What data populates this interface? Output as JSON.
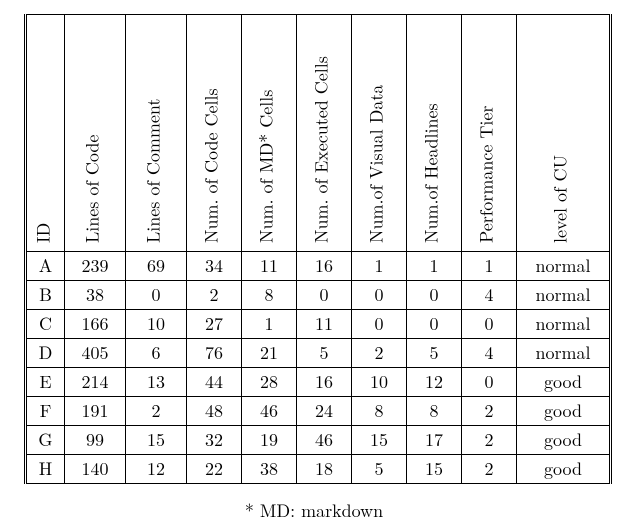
{
  "chart_data": {
    "type": "table",
    "title": "",
    "columns": [
      "ID",
      "Lines of Code",
      "Lines of Comment",
      "Num. of Code Cells",
      "Num. of MD* Cells",
      "Num. of Executed Cells",
      "Num.of Visual Data",
      "Num.of Headlines",
      "Performance Tier",
      "level of CU"
    ],
    "rows": [
      {
        "id": "A",
        "lines_of_code": 239,
        "lines_of_comment": 69,
        "num_code_cells": 34,
        "num_md_cells": 11,
        "num_executed_cells": 16,
        "num_visual_data": 1,
        "num_headlines": 1,
        "performance_tier": 1,
        "level_of_cu": "normal"
      },
      {
        "id": "B",
        "lines_of_code": 38,
        "lines_of_comment": 0,
        "num_code_cells": 2,
        "num_md_cells": 8,
        "num_executed_cells": 0,
        "num_visual_data": 0,
        "num_headlines": 0,
        "performance_tier": 4,
        "level_of_cu": "normal"
      },
      {
        "id": "C",
        "lines_of_code": 166,
        "lines_of_comment": 10,
        "num_code_cells": 27,
        "num_md_cells": 1,
        "num_executed_cells": 11,
        "num_visual_data": 0,
        "num_headlines": 0,
        "performance_tier": 0,
        "level_of_cu": "normal"
      },
      {
        "id": "D",
        "lines_of_code": 405,
        "lines_of_comment": 6,
        "num_code_cells": 76,
        "num_md_cells": 21,
        "num_executed_cells": 5,
        "num_visual_data": 2,
        "num_headlines": 5,
        "performance_tier": 4,
        "level_of_cu": "normal"
      },
      {
        "id": "E",
        "lines_of_code": 214,
        "lines_of_comment": 13,
        "num_code_cells": 44,
        "num_md_cells": 28,
        "num_executed_cells": 16,
        "num_visual_data": 10,
        "num_headlines": 12,
        "performance_tier": 0,
        "level_of_cu": "good"
      },
      {
        "id": "F",
        "lines_of_code": 191,
        "lines_of_comment": 2,
        "num_code_cells": 48,
        "num_md_cells": 46,
        "num_executed_cells": 24,
        "num_visual_data": 8,
        "num_headlines": 8,
        "performance_tier": 2,
        "level_of_cu": "good"
      },
      {
        "id": "G",
        "lines_of_code": 99,
        "lines_of_comment": 15,
        "num_code_cells": 32,
        "num_md_cells": 19,
        "num_executed_cells": 46,
        "num_visual_data": 15,
        "num_headlines": 17,
        "performance_tier": 2,
        "level_of_cu": "good"
      },
      {
        "id": "H",
        "lines_of_code": 140,
        "lines_of_comment": 12,
        "num_code_cells": 22,
        "num_md_cells": 38,
        "num_executed_cells": 18,
        "num_visual_data": 5,
        "num_headlines": 15,
        "performance_tier": 2,
        "level_of_cu": "good"
      }
    ],
    "footnote": "* MD: markdown"
  }
}
